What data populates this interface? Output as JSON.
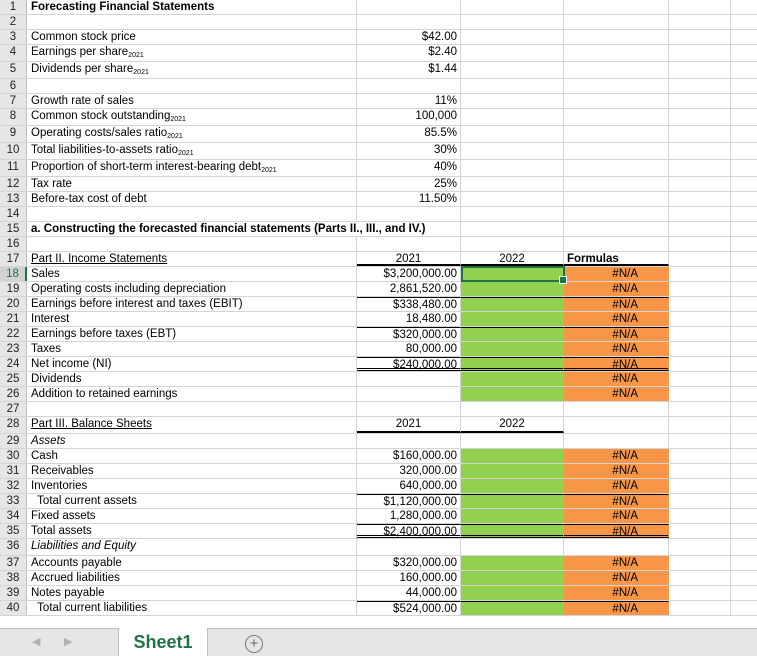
{
  "workbook": {
    "active_sheet": "Sheet1",
    "add_sheet_icon": "plus-circle-icon",
    "selected_cell": "C18"
  },
  "rows": {
    "r1": {
      "num": "1",
      "a": "Forecasting Financial Statements"
    },
    "r2": {
      "num": "2"
    },
    "r3": {
      "num": "3",
      "a": "Common stock price",
      "b": "$42.00"
    },
    "r4": {
      "num": "4",
      "a": "Earnings per share",
      "a_sub": "2021",
      "b": "$2.40"
    },
    "r5": {
      "num": "5",
      "a": "Dividends per share",
      "a_sub": "2021",
      "b": "$1.44"
    },
    "r6": {
      "num": "6"
    },
    "r7": {
      "num": "7",
      "a": "Growth rate of sales",
      "b": "11%"
    },
    "r8": {
      "num": "8",
      "a": "Common stock outstanding",
      "a_sub": "2021",
      "b": "100,000"
    },
    "r9": {
      "num": "9",
      "a": "Operating costs/sales ratio",
      "a_sub": "2021",
      "b": "85.5%"
    },
    "r10": {
      "num": "10",
      "a": "Total liabilities-to-assets ratio",
      "a_sub": "2021",
      "b": "30%"
    },
    "r11": {
      "num": "11",
      "a": "Proportion of short-term interest-bearing debt",
      "a_sub": "2021",
      "b": "40%"
    },
    "r12": {
      "num": "12",
      "a": "Tax rate",
      "b": "25%"
    },
    "r13": {
      "num": "13",
      "a": "Before-tax cost of debt",
      "b": "11.50%"
    },
    "r14": {
      "num": "14"
    },
    "r15": {
      "num": "15",
      "a": "a.  Constructing the forecasted financial statements (Parts II., III., and IV.)"
    },
    "r16": {
      "num": "16"
    },
    "r17": {
      "num": "17",
      "a": "Part II. Income Statements",
      "b": "2021",
      "c": "2022",
      "d": "Formulas"
    },
    "r18": {
      "num": "18",
      "a": "Sales",
      "b": "$3,200,000.00",
      "d": "#N/A"
    },
    "r19": {
      "num": "19",
      "a": "Operating costs including depreciation",
      "b": "2,861,520.00",
      "d": "#N/A"
    },
    "r20": {
      "num": "20",
      "a": "Earnings before interest and taxes (EBIT)",
      "b": "$338,480.00",
      "d": "#N/A"
    },
    "r21": {
      "num": "21",
      "a": "Interest",
      "b": "18,480.00",
      "d": "#N/A"
    },
    "r22": {
      "num": "22",
      "a": "Earnings before taxes (EBT)",
      "b": "$320,000.00",
      "d": "#N/A"
    },
    "r23": {
      "num": "23",
      "a": "Taxes",
      "b": "80,000.00",
      "d": "#N/A"
    },
    "r24": {
      "num": "24",
      "a": "Net income (NI)",
      "b": "$240,000.00",
      "d": "#N/A"
    },
    "r25": {
      "num": "25",
      "a": "Dividends",
      "d": "#N/A"
    },
    "r26": {
      "num": "26",
      "a": "Addition to retained earnings",
      "d": "#N/A"
    },
    "r27": {
      "num": "27"
    },
    "r28": {
      "num": "28",
      "a": "Part III. Balance Sheets",
      "b": "2021",
      "c": "2022"
    },
    "r29": {
      "num": "29",
      "a": "Assets"
    },
    "r30": {
      "num": "30",
      "a": "Cash",
      "b": "$160,000.00",
      "d": "#N/A"
    },
    "r31": {
      "num": "31",
      "a": "Receivables",
      "b": "320,000.00",
      "d": "#N/A"
    },
    "r32": {
      "num": "32",
      "a": "Inventories",
      "b": "640,000.00",
      "d": "#N/A"
    },
    "r33": {
      "num": "33",
      "a": "  Total current assets",
      "b": "$1,120,000.00",
      "d": "#N/A"
    },
    "r34": {
      "num": "34",
      "a": "Fixed assets",
      "b": "1,280,000.00",
      "d": "#N/A"
    },
    "r35": {
      "num": "35",
      "a": "Total assets",
      "b": "$2,400,000.00",
      "d": "#N/A"
    },
    "r36": {
      "num": "36",
      "a": "Liabilities and Equity"
    },
    "r37": {
      "num": "37",
      "a": "Accounts payable",
      "b": "$320,000.00",
      "d": "#N/A"
    },
    "r38": {
      "num": "38",
      "a": "Accrued liabilities",
      "b": "160,000.00",
      "d": "#N/A"
    },
    "r39": {
      "num": "39",
      "a": "Notes payable",
      "b": "44,000.00",
      "d": "#N/A"
    },
    "r40": {
      "num": "40",
      "a": "  Total current liabilities",
      "b": "$524,000.00",
      "d": "#N/A"
    }
  },
  "colors": {
    "input_fill": "#92d050",
    "formula_fill": "#f79646",
    "selection": "#217346"
  }
}
